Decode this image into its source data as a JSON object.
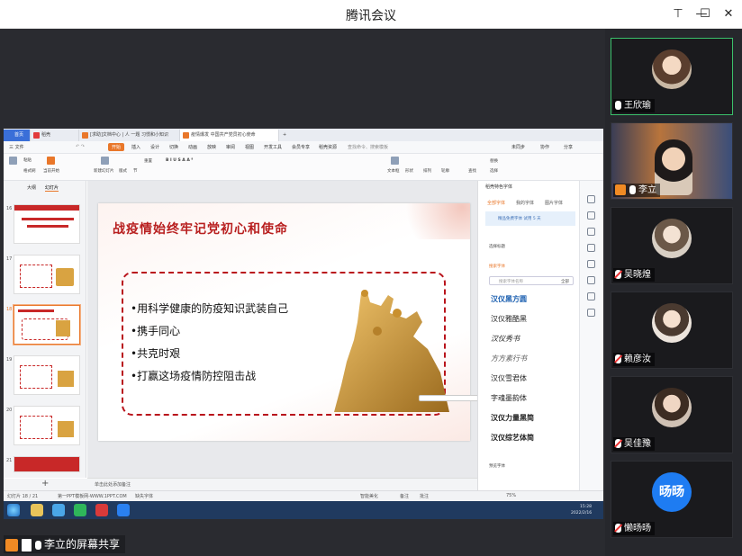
{
  "window": {
    "title": "腾讯会议"
  },
  "wps": {
    "tabs": [
      "首页",
      "稻壳",
      "[求助]文档中心 | 人 一题 习惯和小知识",
      "疫情爆发 中国共产党员初心使命"
    ],
    "menu": [
      "三 文件",
      "开始",
      "插入",
      "设计",
      "切换",
      "动画",
      "放映",
      "审阅",
      "视图",
      "开发工具",
      "会员专享",
      "稻壳资源",
      "查找命令、搜索模板"
    ],
    "menu_active": "开始",
    "menu_right": [
      "未同步",
      "协作",
      "分享"
    ],
    "ribbon_labels": [
      "粘贴",
      "格式刷",
      "当前开始",
      "新建幻灯片",
      "版式",
      "节",
      "重置",
      "文本框",
      "形状",
      "排列",
      "轮廓",
      "查找",
      "替换",
      "选择"
    ],
    "panel_tabs": [
      "大纲",
      "幻灯片"
    ],
    "thumb_numbers": [
      "16",
      "17",
      "18",
      "19",
      "20",
      "21"
    ],
    "slide": {
      "title": "战疫情始终牢记党初心和使命",
      "bullets": [
        "•用科学健康的防疫知识武装自己",
        "•携手同心",
        "•共克时艰",
        "•打赢这场疫情防控阻击战"
      ]
    },
    "notes_placeholder": "单击此处添加备注",
    "right_panel": {
      "title": "稻壳特色字体",
      "tabs": [
        "全部字体",
        "我的字体",
        "图片字体"
      ],
      "tip": "精品免费字体 试用 5 天",
      "sec1": "选择标题",
      "sec2": "搜索字体",
      "search_placeholder": "搜索字体名称",
      "search_btn": "全部",
      "fonts": [
        "汉仪黑方圆",
        "汉仪雅酷黑",
        "汉仪秀书",
        "方方素行书",
        "汉仪雪君体",
        "字魂墨韵体",
        "汉仪力量黑简",
        "汉仪综艺体简"
      ],
      "footer": "预览字体"
    },
    "status": {
      "slide_count": "幻灯片 18 / 21",
      "theme": "第一PPT模板网-WWW.1PPT.COM",
      "missing_font": "缺失字体",
      "note": "智能美化",
      "comment": "备注",
      "annotation": "批注",
      "zoom": "75%"
    },
    "taskbar": {
      "time": "15:28",
      "date": "2022/2/16"
    }
  },
  "share_label": "李立的屏幕共享",
  "participants": [
    {
      "name": "王欣瑜",
      "mic_on": true,
      "active": true
    },
    {
      "name": "李立",
      "mic_on": true,
      "active": false,
      "host": true
    },
    {
      "name": "吴晓煌",
      "mic_on": false
    },
    {
      "name": "赖彦汝",
      "mic_on": false
    },
    {
      "name": "吴佳豫",
      "mic_on": false
    },
    {
      "name": "懒旸旸",
      "mic_on": false,
      "avatar_text": "旸旸"
    }
  ],
  "colors": {
    "accent": "#e9772a",
    "slide_red": "#b81f1f",
    "meeting_bg": "#2a2b30",
    "avatar_blue": "#1e7cf2"
  }
}
